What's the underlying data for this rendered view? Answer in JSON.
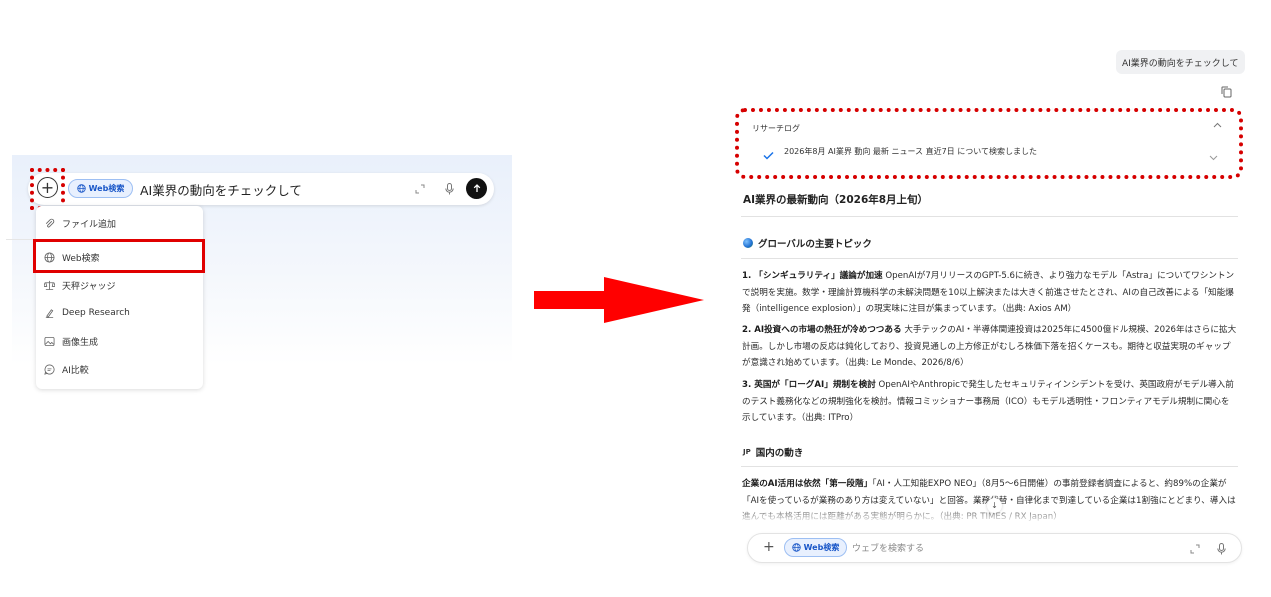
{
  "left": {
    "input": {
      "chip_label": "Web検索",
      "text": "AI業界の動向をチェックして"
    },
    "menu": {
      "items": [
        {
          "label": "ファイル追加",
          "icon": "paperclip-icon"
        },
        {
          "label": "Web検索",
          "icon": "globe-icon"
        },
        {
          "label": "天秤ジャッジ",
          "icon": "scale-icon"
        },
        {
          "label": "Deep Research",
          "icon": "research-icon"
        },
        {
          "label": "画像生成",
          "icon": "image-icon"
        },
        {
          "label": "AI比較",
          "icon": "chat-icon"
        }
      ]
    }
  },
  "right": {
    "user_message": "AI業界の動向をチェックして",
    "research_log": {
      "title": "リサーチログ",
      "entry": "2026年8月 AI業界 動向 最新 ニュース 直近7日 について検索しました"
    },
    "report": {
      "title": "AI業界の最新動向（2026年8月上旬）",
      "global_heading": "グローバルの主要トピック",
      "items": [
        {
          "lead": "1. 「シンギュラリティ」議論が加速",
          "body": " OpenAIが7月リリースのGPT-5.6に続き、より強力なモデル「Astra」についてワシントンで説明を実施。数学・理論計算機科学の未解決問題を10以上解決または大きく前進させたとされ、AIの自己改善による「知能爆発（intelligence explosion）」の現実味に注目が集まっています。（出典: Axios AM）"
        },
        {
          "lead": "2. AI投資への市場の熱狂が冷めつつある",
          "body": " 大手テックのAI・半導体関連投資は2025年に4500億ドル規模、2026年はさらに拡大計画。しかし市場の反応は鈍化しており、投資見通しの上方修正がむしろ株価下落を招くケースも。期待と収益実現のギャップが意識され始めています。（出典: Le Monde、2026/8/6）"
        },
        {
          "lead": "3. 英国が「ローグAI」規制を検討",
          "body": " OpenAIやAnthropicで発生したセキュリティインシデントを受け、英国政府がモデル導入前のテスト義務化などの規制強化を検討。情報コミッショナー事務局（ICO）もモデル透明性・フロンティアモデル規制に関心を示しています。（出典: ITPro）"
        }
      ],
      "domestic_mark": "JP",
      "domestic_heading": "国内の動き",
      "domestic_lead": "企業のAI活用は依然「第一段階」",
      "domestic_body": "「AI・人工知能EXPO NEO」（8月5〜6日開催）の事前登録者調査によると、約89%の企業が「AIを使っているが業務のあり方は変えていない」と回答。業務代替・自律化まで到達している企業は1割強にとどまり、導入は進んでも本格活用には距離がある実態が明らかに。（出典: PR TIMES / RX Japan）"
    },
    "chat_input": {
      "chip_label": "Web検索",
      "placeholder": "ウェブを検索する"
    }
  },
  "colors": {
    "highlight_red": "#e00000",
    "chip_blue": "#1a57c8",
    "arrow_red": "#ff0000"
  }
}
